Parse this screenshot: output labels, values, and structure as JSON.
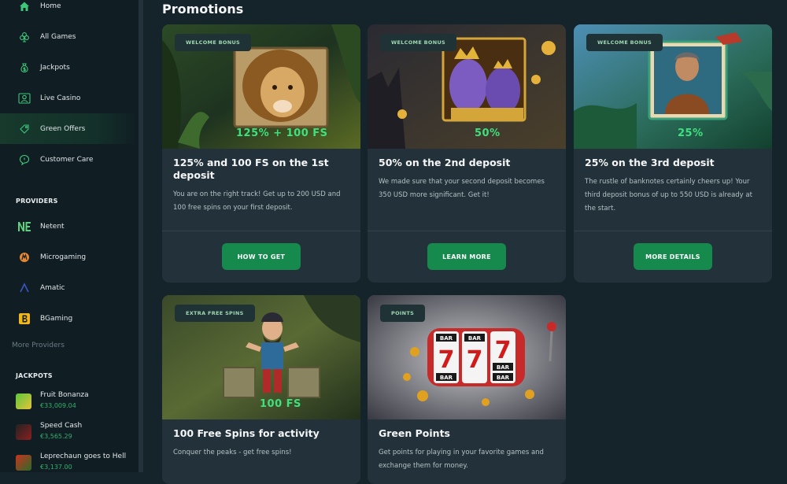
{
  "sidebar": {
    "nav": [
      {
        "label": "Home",
        "icon": "home-icon"
      },
      {
        "label": "All Games",
        "icon": "clubs-icon"
      },
      {
        "label": "Jackpots",
        "icon": "money-bag-icon"
      },
      {
        "label": "Live Casino",
        "icon": "dealer-icon"
      },
      {
        "label": "Green Offers",
        "icon": "tag-icon",
        "active": true
      },
      {
        "label": "Customer Care",
        "icon": "support-icon"
      }
    ],
    "providers_heading": "PROVIDERS",
    "providers": [
      {
        "label": "Netent",
        "icon": "netent-logo-icon"
      },
      {
        "label": "Microgaming",
        "icon": "microgaming-logo-icon"
      },
      {
        "label": "Amatic",
        "icon": "amatic-logo-icon"
      },
      {
        "label": "BGaming",
        "icon": "bgaming-logo-icon"
      }
    ],
    "more_providers": "More Providers",
    "jackpots_heading": "JACKPOTS",
    "jackpots": [
      {
        "name": "Fruit Bonanza",
        "amount": "€33,009.04"
      },
      {
        "name": "Speed Cash",
        "amount": "€3,565.29"
      },
      {
        "name": "Leprechaun goes to Hell",
        "amount": "€3,137.00"
      }
    ]
  },
  "main": {
    "title": "Promotions",
    "cards": [
      {
        "badge": "WELCOME BONUS",
        "image_text": "125% + 100 FS",
        "title": "125% and 100 FS on the 1st deposit",
        "description": "You are on the right track! Get up to 200 USD and 100 free spins on your first deposit.",
        "button": "HOW TO GET"
      },
      {
        "badge": "WELCOME BONUS",
        "image_text": "50%",
        "title": "50% on the 2nd deposit",
        "description": "We made sure that your second deposit becomes 350 USD more significant. Get it!",
        "button": "LEARN MORE"
      },
      {
        "badge": "WELCOME BONUS",
        "image_text": "25%",
        "title": "25% on the 3rd deposit",
        "description": "The rustle of banknotes certainly cheers up! Your third deposit bonus of up to 550 USD is already at the start.",
        "button": "MORE DETAILS"
      },
      {
        "badge": "EXTRA FREE SPINS",
        "image_text": "100 FS",
        "title": "100 Free Spins for activity",
        "description": "Conquer the peaks - get free spins!"
      },
      {
        "badge": "POINTS",
        "title": "Green Points",
        "description": "Get points for playing in your favorite games and exchange them for money.",
        "reel_labels": [
          "BAR",
          "BAR",
          "BAR",
          "BAR",
          "BAR"
        ],
        "reel_digit": "7"
      }
    ]
  },
  "colors": {
    "accent_green": "#16894d",
    "highlight_green": "#3fe07e",
    "background": "#15232b",
    "card": "#23323a",
    "sidebar": "#101d23"
  }
}
